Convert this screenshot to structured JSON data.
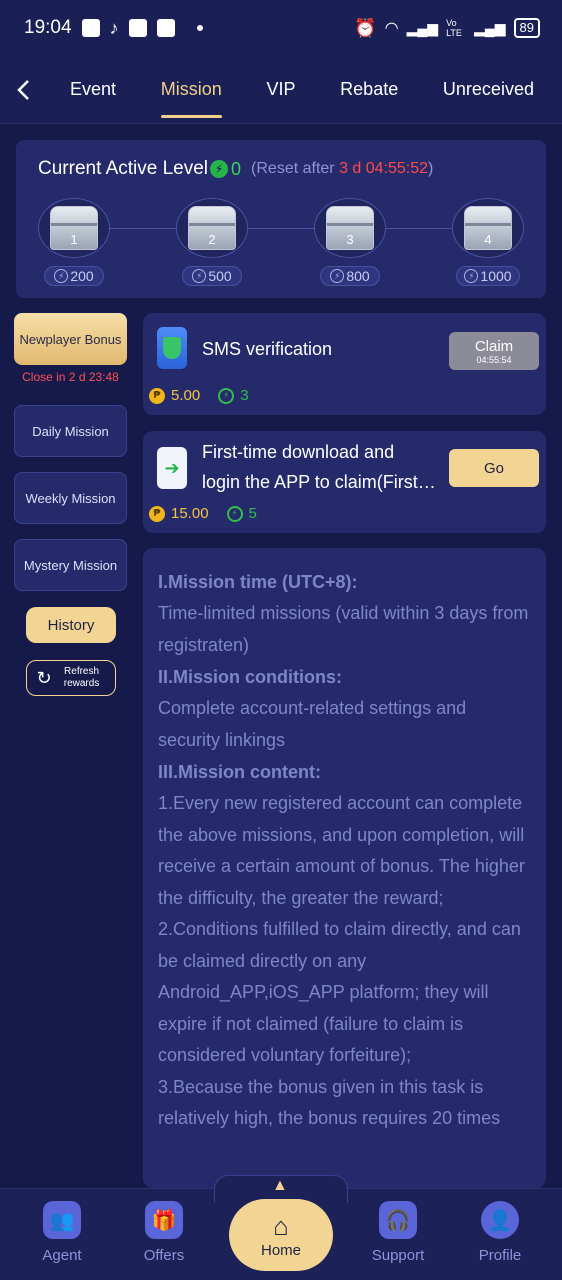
{
  "status_bar": {
    "time": "19:04",
    "battery": "89",
    "network": "Vo LTE"
  },
  "nav": {
    "tabs": [
      {
        "label": "Event"
      },
      {
        "label": "Mission"
      },
      {
        "label": "VIP"
      },
      {
        "label": "Rebate"
      },
      {
        "label": "Unreceived"
      }
    ],
    "active_tab": "Mission"
  },
  "level_card": {
    "title": "Current Active Level",
    "level_value": "0",
    "reset_prefix": "(Reset after ",
    "reset_time": "3 d 04:55:52",
    "reset_suffix": ")",
    "chests": [
      {
        "label": "1",
        "reward": "200"
      },
      {
        "label": "2",
        "reward": "500"
      },
      {
        "label": "3",
        "reward": "800"
      },
      {
        "label": "4",
        "reward": "1000"
      }
    ]
  },
  "sidebar": {
    "items": [
      {
        "label": "Newplayer Bonus"
      },
      {
        "label": "Daily Mission"
      },
      {
        "label": "Weekly Mission"
      },
      {
        "label": "Mystery Mission"
      }
    ],
    "close_in": "Close in 2 d 23:48",
    "history": "History",
    "refresh": "Refresh rewards"
  },
  "missions": [
    {
      "title": "SMS verification",
      "button_label": "Claim",
      "button_sub": "04:55:54",
      "coins": "5.00",
      "points": "3"
    },
    {
      "title_line1": "First-time download and",
      "title_line2": "login the APP to claim(First…",
      "button_label": "Go",
      "coins": "15.00",
      "points": "5"
    }
  ],
  "rules": {
    "h1": "I.Mission time (UTC+8):",
    "p1": "Time-limited missions (valid within 3 days from registraten)",
    "h2": "II.Mission conditions:",
    "p2": "Complete account-related settings and security linkings",
    "h3": "III.Mission content:",
    "p3": "1.Every new registered account can complete the above missions, and upon completion, will receive a certain amount of bonus. The higher the difficulty, the greater the reward;",
    "p4": "2.Conditions fulfilled to claim directly, and can be claimed directly on any Android_APP,iOS_APP platform; they will expire if not claimed (failure to claim is considered voluntary forfeiture);",
    "p5": "3.Because the bonus given in this task is relatively high, the bonus requires 20 times"
  },
  "bottom_nav": {
    "items": [
      {
        "label": "Agent"
      },
      {
        "label": "Offers"
      },
      {
        "label": "Home"
      },
      {
        "label": "Support"
      },
      {
        "label": "Profile"
      }
    ]
  },
  "colors": {
    "background": "#161a4a",
    "card": "#252b6a",
    "accent_gold": "#f2d592",
    "active_tab": "#f2cf8a",
    "green": "#2ebe4f",
    "red": "#ff4a4a"
  }
}
